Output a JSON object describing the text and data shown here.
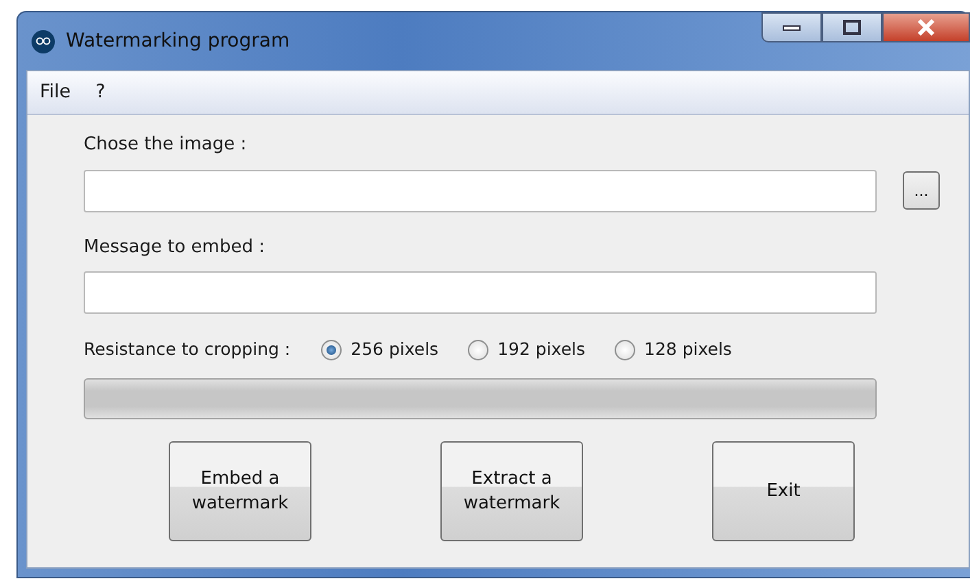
{
  "window": {
    "title": "Watermarking program"
  },
  "menu": [
    "File",
    "?"
  ],
  "image_field": {
    "label": "Chose the image :",
    "browse_button": "..."
  },
  "message_field": {
    "label": "Message to embed :"
  },
  "resistance": {
    "label": "Resistance to cropping :",
    "options": [
      {
        "label": "256 pixels",
        "selected": true
      },
      {
        "label": "192 pixels",
        "selected": false
      },
      {
        "label": "128 pixels",
        "selected": false
      }
    ]
  },
  "progress": {
    "level": 0
  },
  "buttons": [
    "Embed a watermark",
    "Extract a watermark",
    "Exit"
  ]
}
